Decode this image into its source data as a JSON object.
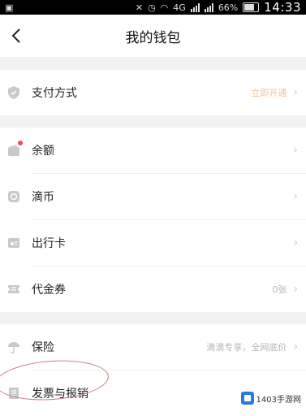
{
  "status_bar": {
    "battery_percent": "66%",
    "time": "14:33",
    "network": "4G"
  },
  "navbar": {
    "title": "我的钱包"
  },
  "payment": {
    "label": "支付方式",
    "value": "立即开通"
  },
  "wallet_items": [
    {
      "label": "余额",
      "value": "",
      "icon": "wallet-icon",
      "badge": true
    },
    {
      "label": "滴币",
      "value": "",
      "icon": "coin-icon",
      "badge": false
    },
    {
      "label": "出行卡",
      "value": "",
      "icon": "card-icon",
      "badge": false
    },
    {
      "label": "代金券",
      "value": "0张",
      "icon": "coupon-icon",
      "badge": false
    }
  ],
  "insurance": {
    "label": "保险",
    "value": "滴滴专享，全网底价"
  },
  "invoice": {
    "label": "发票与报销"
  },
  "watermark": {
    "text": "1403手游网"
  },
  "colors": {
    "accent_orange": "#f0c49a",
    "badge_red": "#e5525a",
    "annotation_circle": "#c87a7a"
  }
}
